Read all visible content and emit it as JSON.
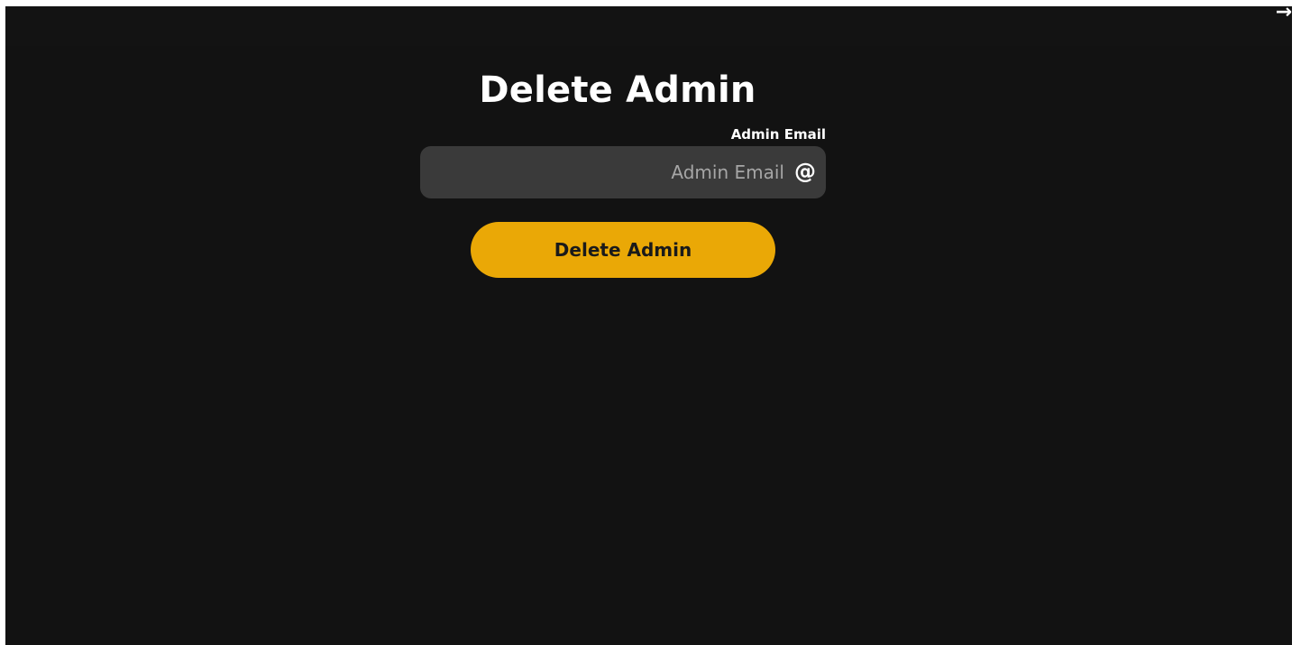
{
  "page": {
    "title": "Delete Admin"
  },
  "form": {
    "email_label": "Admin Email",
    "email_placeholder": "Admin Email",
    "email_value": "",
    "email_icon": "at-icon",
    "submit_label": "Delete Admin"
  },
  "window": {
    "corner_icon": "arrow-right-icon",
    "corner_glyph": "→"
  },
  "colors": {
    "background": "#121212",
    "input_background": "#3a3a3a",
    "accent": "#eaa806",
    "text": "#ffffff",
    "placeholder": "#a6a6a6"
  }
}
